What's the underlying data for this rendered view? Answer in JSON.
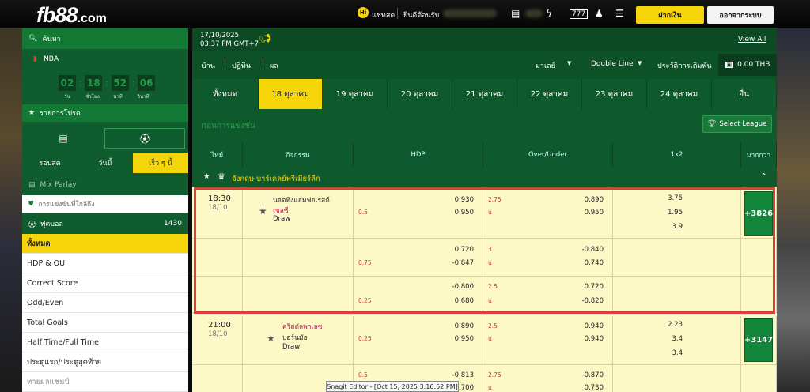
{
  "topbar": {
    "logo_main": "fb88",
    "logo_suffix": ".com",
    "chat_label": "แชทสด",
    "welcome": "ยินดีต้อนรับ",
    "deposit_button": "ฝากเงิน",
    "logout_button": "ออกจากระบบ"
  },
  "sidebar": {
    "search_label": "ค้นหา",
    "sport_label": "NBA",
    "timer_labels": [
      "วัน",
      "ชั่วโมง",
      "นาที",
      "วินาที"
    ],
    "timer_values": [
      "02",
      "18",
      "52",
      "06"
    ],
    "favorites_label": "รายการโปรด",
    "live_tabs": [
      "รอบสด",
      "วันนี้",
      "เร็ว ๆ นี้"
    ],
    "mix_parlay": "Mix Parlay",
    "upcoming": "การแข่งขันที่ใกล้ถึง",
    "football": "ฟุตบอล",
    "football_count": "1430",
    "menu": [
      "ทั้งหมด",
      "HDP & OU",
      "Correct Score",
      "Odd/Even",
      "Total Goals",
      "Half Time/Full Time",
      "ประตูแรก/ประตูสุดท้าย",
      "ทายผลแชมป์"
    ]
  },
  "header": {
    "date": "17/10/2025",
    "time": "03:37 PM GMT+7",
    "view_all": "View All",
    "nav": [
      "บ้าน",
      "ปฏิทิน",
      "ผล"
    ],
    "language": "มาเลย์",
    "line": "Double Line",
    "history": "ประวัติการเดิมพัน",
    "balance": "0.00 THB"
  },
  "tabs": [
    "ทั้งหมด",
    "18 ตุลาคม",
    "19 ตุลาคม",
    "20 ตุลาคม",
    "21 ตุลาคม",
    "22 ตุลาคม",
    "23 ตุลาคม",
    "24 ตุลาคม",
    "อื่น"
  ],
  "section_title": "ก่อนการแข่งขัน",
  "select_league": "Select League",
  "columns": [
    "ไทม์",
    "กิจกรรม",
    "HDP",
    "Over/Under",
    "1x2",
    "มากกว่า"
  ],
  "league": "อังกฤษ พรีเมียร์ลีก",
  "league_display": "อังกฤษ บาร์เคลย์พรีเมียร์ลีก",
  "matches": [
    {
      "time": "18:30",
      "date": "18/10",
      "home": "นอตทิงแฮมฟอเรสต์",
      "away": "เชลซี",
      "draw": "Draw",
      "more": "+3826",
      "rows": [
        {
          "hdp_line": "0.5",
          "hdp_home": "0.930",
          "hdp_away": "0.950",
          "ou_line": "2.75",
          "ou_u": "u",
          "ou_over": "0.890",
          "ou_under": "0.950",
          "x1": "3.75",
          "x2": "1.95",
          "x3": "3.9"
        },
        {
          "hdp_line": "0.75",
          "hdp_home": "0.720",
          "hdp_away": "-0.847",
          "ou_line": "3",
          "ou_u": "u",
          "ou_over": "-0.840",
          "ou_under": "0.740"
        },
        {
          "hdp_line": "0.25",
          "hdp_home": "-0.800",
          "hdp_away": "0.680",
          "ou_line": "2.5",
          "ou_u": "u",
          "ou_over": "0.720",
          "ou_under": "-0.820"
        }
      ]
    },
    {
      "time": "21:00",
      "date": "18/10",
      "home": "คริสตัลพาเลซ",
      "away": "บอร์นมัธ",
      "draw": "Draw",
      "more": "+3147",
      "rows": [
        {
          "hdp_line": "0.25",
          "hdp_home": "0.890",
          "hdp_away": "0.950",
          "ou_line": "2.5",
          "ou_u": "u",
          "ou_over": "0.940",
          "ou_under": "0.940",
          "x1": "2.23",
          "x2": "3.4",
          "x3": "3.4"
        },
        {
          "hdp_line": "0.5",
          "hdp_home": "-0.813",
          "hdp_away": "0.700",
          "ou_line": "2.75",
          "ou_u": "u",
          "ou_over": "-0.870",
          "ou_under": "0.730"
        }
      ]
    }
  ],
  "tooltip": "Snagit Editor - [Oct 15, 2025 3:16:52 PM]"
}
